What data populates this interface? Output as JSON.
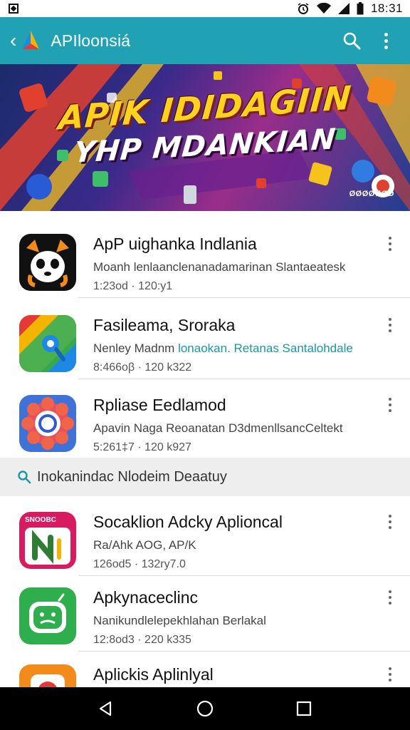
{
  "status_bar": {
    "time": "18:31",
    "icons": [
      "image-icon",
      "alarm-icon",
      "wifi-icon",
      "signal-icon",
      "battery-icon"
    ]
  },
  "app_bar": {
    "title": "APIloonsiá",
    "color": "#21a2b4",
    "actions": [
      "search-icon",
      "more-vert-icon"
    ]
  },
  "banner": {
    "line1": "APIK IDIDAGIIN",
    "line2": "YHP MDANKIAN",
    "caption": "ØØØØØØØ"
  },
  "apps_top": [
    {
      "name": "ApP uighanka Indlania",
      "desc": "Moanh lenlaanclenanadamarinan Slantaeatesk",
      "desc_highlight": "",
      "meta": "1:23od · 120:y1",
      "icon": "panda-app-icon"
    },
    {
      "name": "Fasileama, Sroraka",
      "desc": "Nenley Madnm ",
      "desc_highlight": "lonaokan. Retanas Santalohdale",
      "meta": "8:466oβ · 120 k322",
      "icon": "maps-app-icon"
    },
    {
      "name": "Rpliase Eedlamod",
      "desc": "Apavin Naga Reoanatan D3dmenllsancCeltekt",
      "desc_highlight": "",
      "meta": "5:261‡7 · 120 k927",
      "icon": "camera-app-icon"
    }
  ],
  "section": {
    "title": "Inokanindac Nlodeim Deaatuy"
  },
  "apps_bottom": [
    {
      "name": "Socaklion Adcky Aplioncal",
      "desc": "Ra/Ahk AOG, AP/K",
      "desc_highlight": "",
      "meta": "126od5 · 132ry7.0",
      "icon": "social-app-icon",
      "badge": "SNOOBC"
    },
    {
      "name": "Apkynaceclinc",
      "desc": "Nanikundlelepekhlahan Berlakal",
      "desc_highlight": "",
      "meta": "12:8od3 · 220 k335",
      "icon": "robot-app-icon"
    },
    {
      "name": "Aplickis Aplinlyal",
      "desc": "",
      "desc_highlight": "",
      "meta": "",
      "icon": "chrome-app-icon"
    }
  ],
  "nav_bar": {
    "buttons": [
      "back-nav-icon",
      "home-nav-icon",
      "recents-nav-icon"
    ]
  }
}
